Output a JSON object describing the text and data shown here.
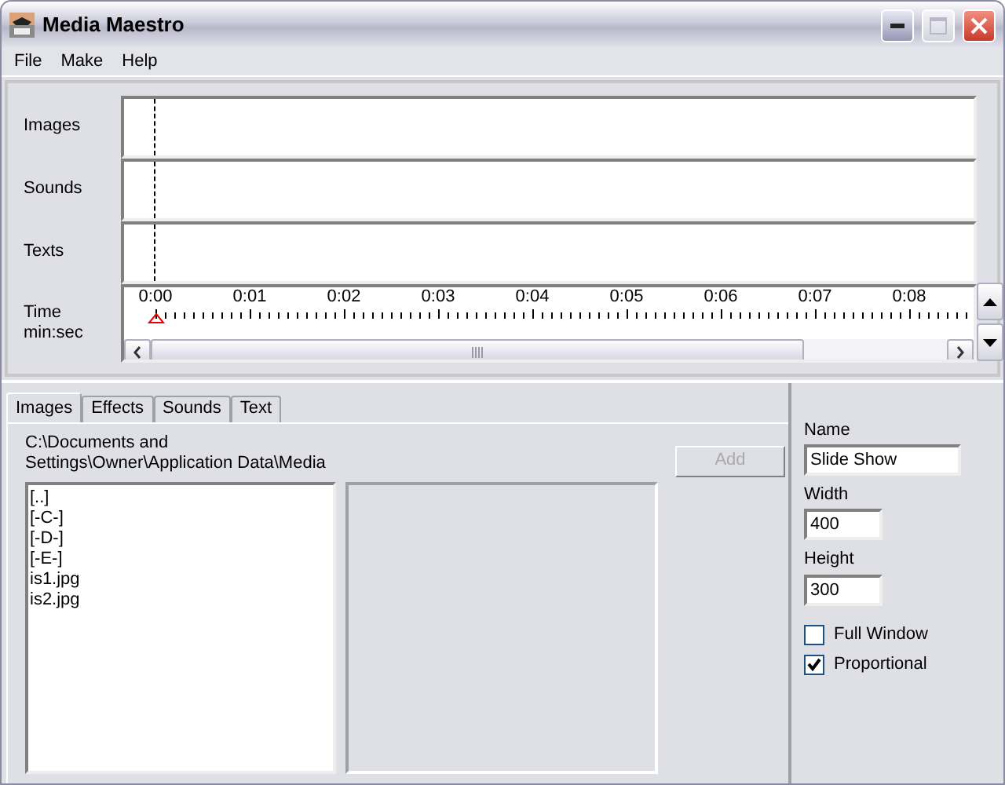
{
  "window": {
    "title": "Media Maestro"
  },
  "menu": [
    "File",
    "Make",
    "Help"
  ],
  "tracks": [
    {
      "label": "Images"
    },
    {
      "label": "Sounds"
    },
    {
      "label": "Texts"
    }
  ],
  "time_label": [
    "Time",
    "min:sec"
  ],
  "ruler_ticks": [
    "0:00",
    "0:01",
    "0:02",
    "0:03",
    "0:04",
    "0:05",
    "0:06",
    "0:07",
    "0:08"
  ],
  "tabs": [
    {
      "label": "Images",
      "selected": true
    },
    {
      "label": "Effects",
      "selected": false
    },
    {
      "label": "Sounds",
      "selected": false
    },
    {
      "label": "Text",
      "selected": false
    }
  ],
  "path": "C:\\Documents and Settings\\Owner\\Application Data\\Media",
  "add_button": {
    "label": "Add",
    "disabled": true
  },
  "files": [
    "[..]",
    "[-C-]",
    "[-D-]",
    "[-E-]",
    "is1.jpg",
    "is2.jpg"
  ],
  "properties": [
    {
      "label": "Name",
      "value": "Slide Show"
    },
    {
      "label": "Width",
      "value": "400"
    },
    {
      "label": "Height",
      "value": "300"
    }
  ],
  "options": [
    {
      "label": "Full Window",
      "checked": false
    },
    {
      "label": "Proportional",
      "checked": true
    }
  ]
}
